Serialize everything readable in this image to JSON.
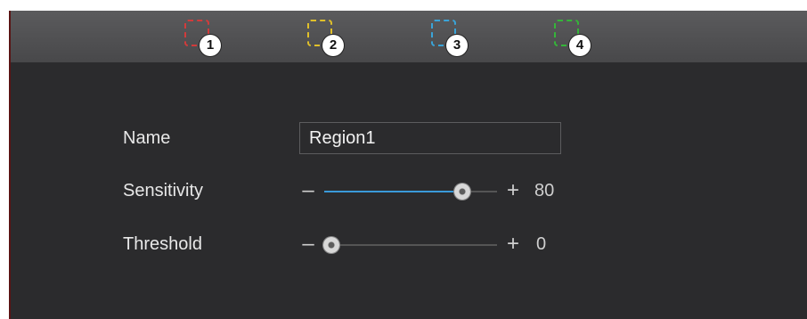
{
  "regions": [
    {
      "number": "1",
      "color": "#d23b3b"
    },
    {
      "number": "2",
      "color": "#e0c02a"
    },
    {
      "number": "3",
      "color": "#3aa4d8"
    },
    {
      "number": "4",
      "color": "#35b539"
    }
  ],
  "form": {
    "name_label": "Name",
    "name_value": "Region1",
    "sensitivity_label": "Sensitivity",
    "sensitivity_value": "80",
    "threshold_label": "Threshold",
    "threshold_value": "0",
    "minus_symbol": "–",
    "plus_symbol": "+"
  },
  "sliders": {
    "sensitivity_fraction": 0.8,
    "threshold_fraction": 0.0,
    "fill_color": "#3a9ad9"
  }
}
